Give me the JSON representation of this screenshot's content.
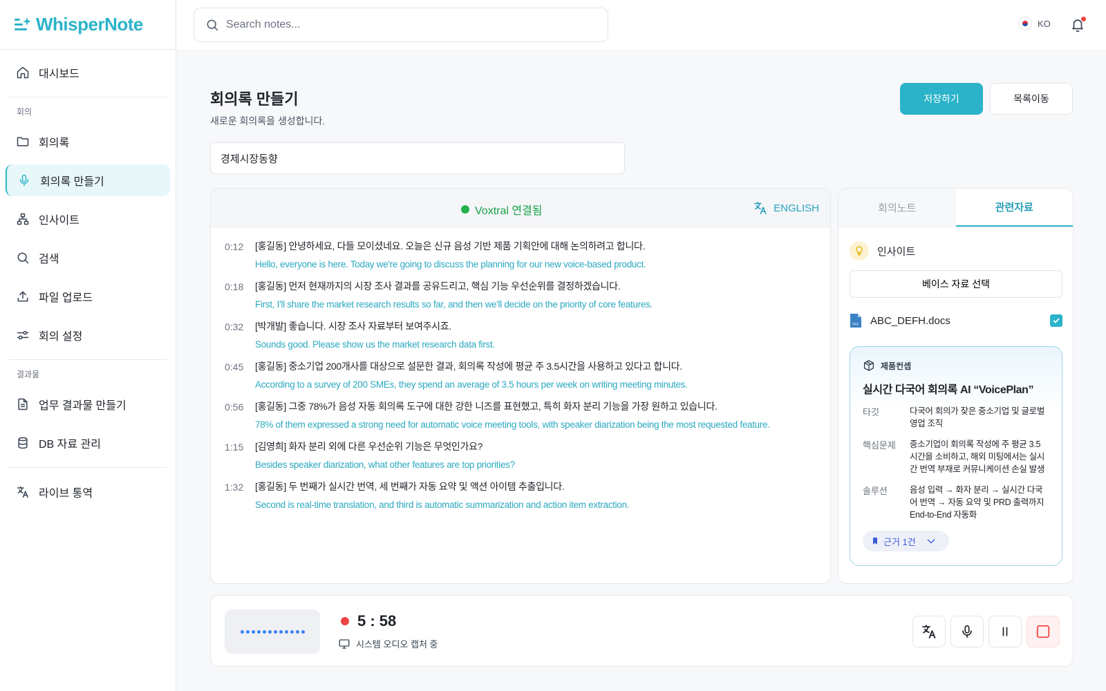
{
  "app": {
    "name": "WhisperNote"
  },
  "search": {
    "placeholder": "Search notes..."
  },
  "header": {
    "language": "KO"
  },
  "sidebar": {
    "items_top": [
      {
        "label": "대시보드",
        "icon": "home-icon"
      }
    ],
    "section_meeting": "회의",
    "items_meeting": [
      {
        "label": "회의록",
        "icon": "folder-icon"
      },
      {
        "label": "회의록 만들기",
        "icon": "mic-icon",
        "active": true
      },
      {
        "label": "인사이트",
        "icon": "hierarchy-icon"
      },
      {
        "label": "검색",
        "icon": "search-icon"
      },
      {
        "label": "파일 업로드",
        "icon": "upload-icon"
      },
      {
        "label": "회의 설정",
        "icon": "sliders-icon"
      }
    ],
    "section_output": "결과물",
    "items_output": [
      {
        "label": "업무 결과물 만들기",
        "icon": "document-icon"
      },
      {
        "label": "DB 자료 관리",
        "icon": "database-icon"
      }
    ],
    "items_bottom": [
      {
        "label": "라이브 통역",
        "icon": "translate-icon"
      }
    ]
  },
  "page": {
    "title": "회의록 만들기",
    "subtitle": "새로운 회의록을 생성합니다.",
    "save_label": "저장하기",
    "list_label": "목록이동",
    "meeting_title_value": "경제시장동향"
  },
  "transcript": {
    "status": "Voxtral 연결됨",
    "language": "ENGLISH",
    "lines": [
      {
        "time": "0:12",
        "ko": "[홍길동] 안녕하세요, 다들 모이셨네요. 오늘은 신규 음성 기반 제품 기획안에 대해 논의하려고 합니다.",
        "en": "Hello, everyone is here. Today we're going to discuss the planning for our new voice-based product."
      },
      {
        "time": "0:18",
        "ko": "[홍길동] 먼저 현재까지의 시장 조사 결과를 공유드리고, 핵심 기능 우선순위를 결정하겠습니다.",
        "en": "First, I'll share the market research results so far, and then we'll decide on the priority of core features."
      },
      {
        "time": "0:32",
        "ko": "[박개발] 좋습니다. 시장 조사 자료부터 보여주시죠.",
        "en": "Sounds good. Please show us the market research data first."
      },
      {
        "time": "0:45",
        "ko": "[홍길동] 중소기업 200개사를 대상으로 설문한 결과, 회의록 작성에 평균 주 3.5시간을 사용하고 있다고 합니다.",
        "en": "According to a survey of 200 SMEs, they spend an average of 3.5 hours per week on writing meeting minutes."
      },
      {
        "time": "0:56",
        "ko": "[홍길동] 그중 78%가 음성 자동 회의록 도구에 대한 강한 니즈를 표현했고, 특히 화자 분리 기능을 가장 원하고 있습니다.",
        "en": "78% of them expressed a strong need for automatic voice meeting tools, with speaker diarization being the most requested feature."
      },
      {
        "time": "1:15",
        "ko": "[김영희] 화자 분리 외에 다른 우선순위 기능은 무엇인가요?",
        "en": "Besides speaker diarization, what other features are top priorities?"
      },
      {
        "time": "1:32",
        "ko": "[홍길동] 두 번째가 실시간 번역, 세 번째가 자동 요약 및 액션 아이템 추출입니다.",
        "en": "Second is real-time translation, and third is automatic summarization and action item extraction."
      }
    ]
  },
  "side": {
    "tabs": [
      {
        "label": "회의노트"
      },
      {
        "label": "관련자료",
        "active": true
      }
    ],
    "insight_label": "인사이트",
    "base_select_label": "베이스 자료 선택",
    "file": {
      "name": "ABC_DEFH.docs",
      "checked": true,
      "badge": "DOC"
    },
    "card": {
      "tag": "제품컨셉",
      "title": "실시간 다국어 회의록 AI “VoicePlan”",
      "rows": [
        {
          "k": "타깃",
          "v": "다국어 회의가 잦은 중소기업 및 글로벌 영업 조직"
        },
        {
          "k": "핵심문제",
          "v": "중소기업이 회의록 작성에 주 평균 3.5 시간을 소비하고, 해외 미팅에서는 실시 간 번역 부재로 커뮤니케이션 손실 발생"
        },
        {
          "k": "솔루션",
          "v": "음성 입력 → 화자 분리 → 실시간 다국 어 번역 → 자동 요약 및 PRD 출력까지 End-to-End 자동화"
        }
      ],
      "evidence_label": "근거 1건"
    }
  },
  "recorder": {
    "time": "5 : 58",
    "status": "시스템 오디오 캡처 중",
    "wave_dots": 12
  },
  "colors": {
    "accent": "#2bb3c9",
    "connected": "#22b14c",
    "record": "#ef4444",
    "translation_text": "#2ba9bf"
  }
}
